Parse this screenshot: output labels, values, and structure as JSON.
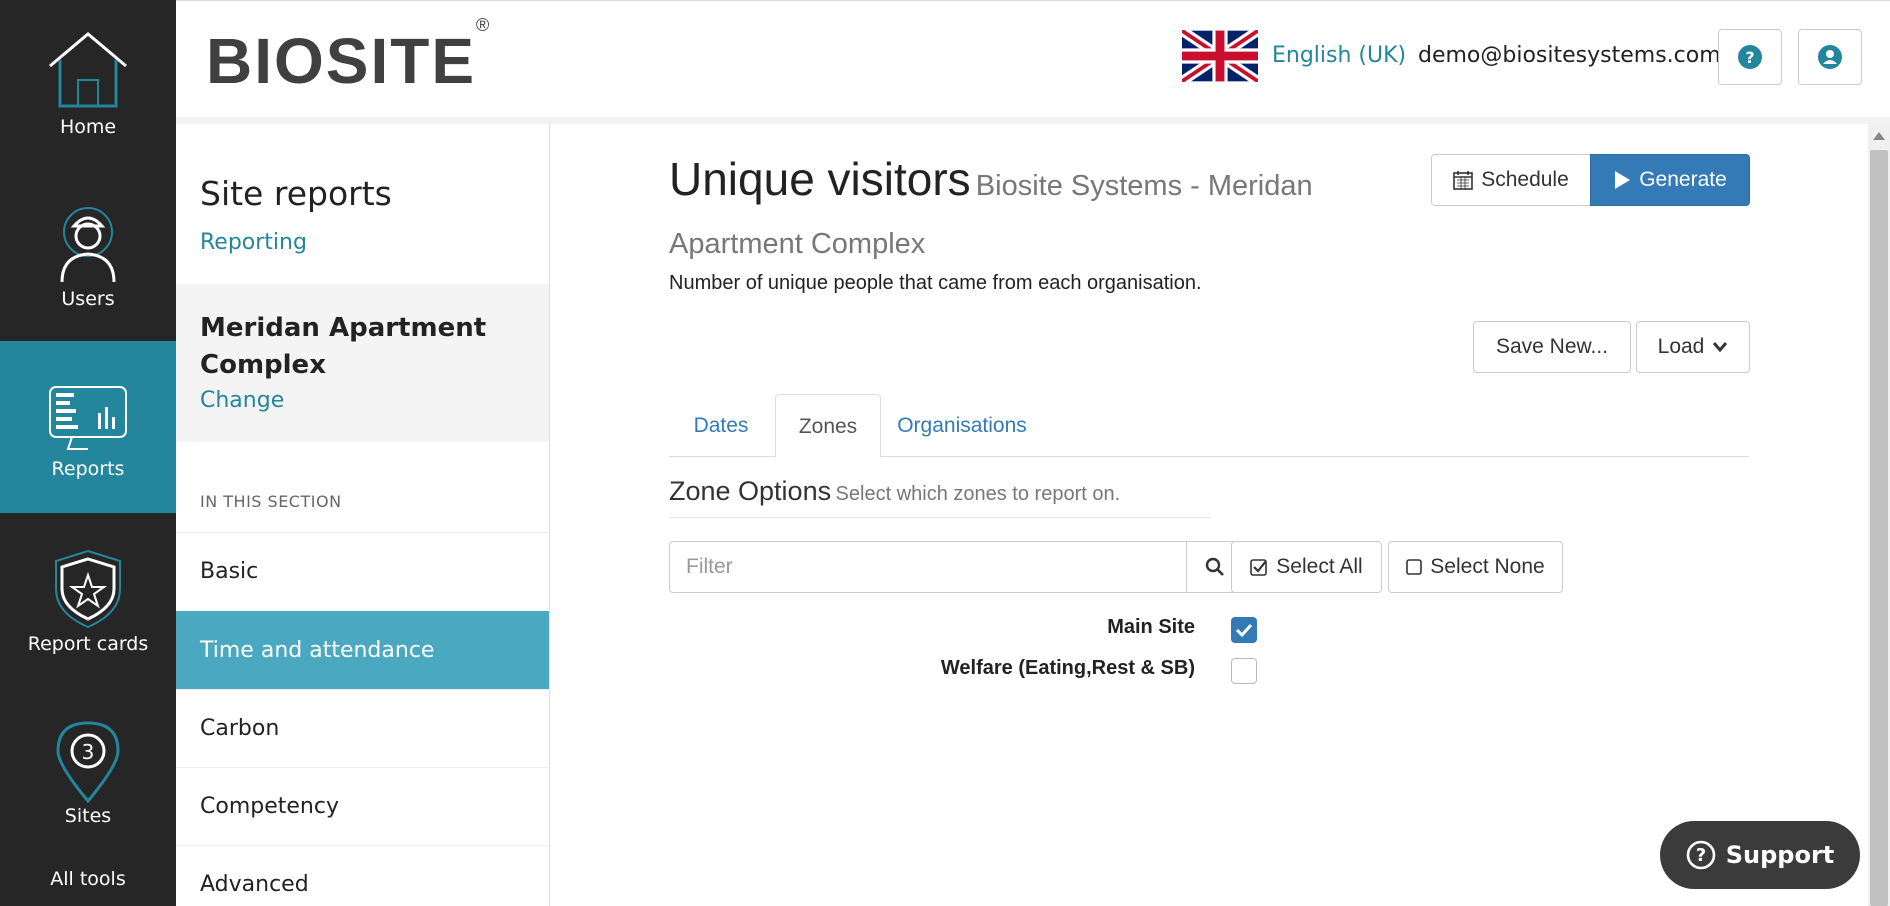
{
  "nav": {
    "home": "Home",
    "users": "Users",
    "reports": "Reports",
    "report_cards": "Report cards",
    "sites": "Sites",
    "all_tools": "All tools"
  },
  "header": {
    "logo": "BIOSITE",
    "logo_mark": "®",
    "language": "English (UK)",
    "email": "demo@biositesystems.com",
    "help_icon": "question-circle-icon",
    "user_icon": "user-circle-icon"
  },
  "side": {
    "title": "Site reports",
    "subtitle": "Reporting",
    "site_name": "Meridan Apartment Complex",
    "change_label": "Change",
    "section_label": "IN THIS SECTION",
    "items": [
      {
        "label": "Basic"
      },
      {
        "label": "Time and attendance"
      },
      {
        "label": "Carbon"
      },
      {
        "label": "Competency"
      },
      {
        "label": "Advanced"
      }
    ],
    "active_item": "Time and attendance"
  },
  "main": {
    "title": "Unique visitors",
    "title_site": "Biosite Systems - Meridan Apartment Complex",
    "description": "Number of unique people that came from each organisation.",
    "schedule_label": "Schedule",
    "generate_label": "Generate",
    "save_new_label": "Save New...",
    "load_label": "Load",
    "tabs": [
      {
        "label": "Dates"
      },
      {
        "label": "Zones"
      },
      {
        "label": "Organisations"
      }
    ],
    "active_tab": "Zones",
    "zone_options_title": "Zone Options",
    "zone_options_sub": "Select which zones to report on.",
    "filter_placeholder": "Filter",
    "select_all_label": "Select All",
    "select_none_label": "Select None",
    "zones": [
      {
        "name": "Main Site",
        "checked": true
      },
      {
        "name": "Welfare (Eating,Rest & SB)",
        "checked": false
      }
    ]
  },
  "support_label": "Support",
  "colors": {
    "nav_bg": "#262626",
    "nav_active": "#23869c",
    "accent": "#23869c",
    "primary": "#337ab7",
    "side_active": "#4aa8c0"
  }
}
